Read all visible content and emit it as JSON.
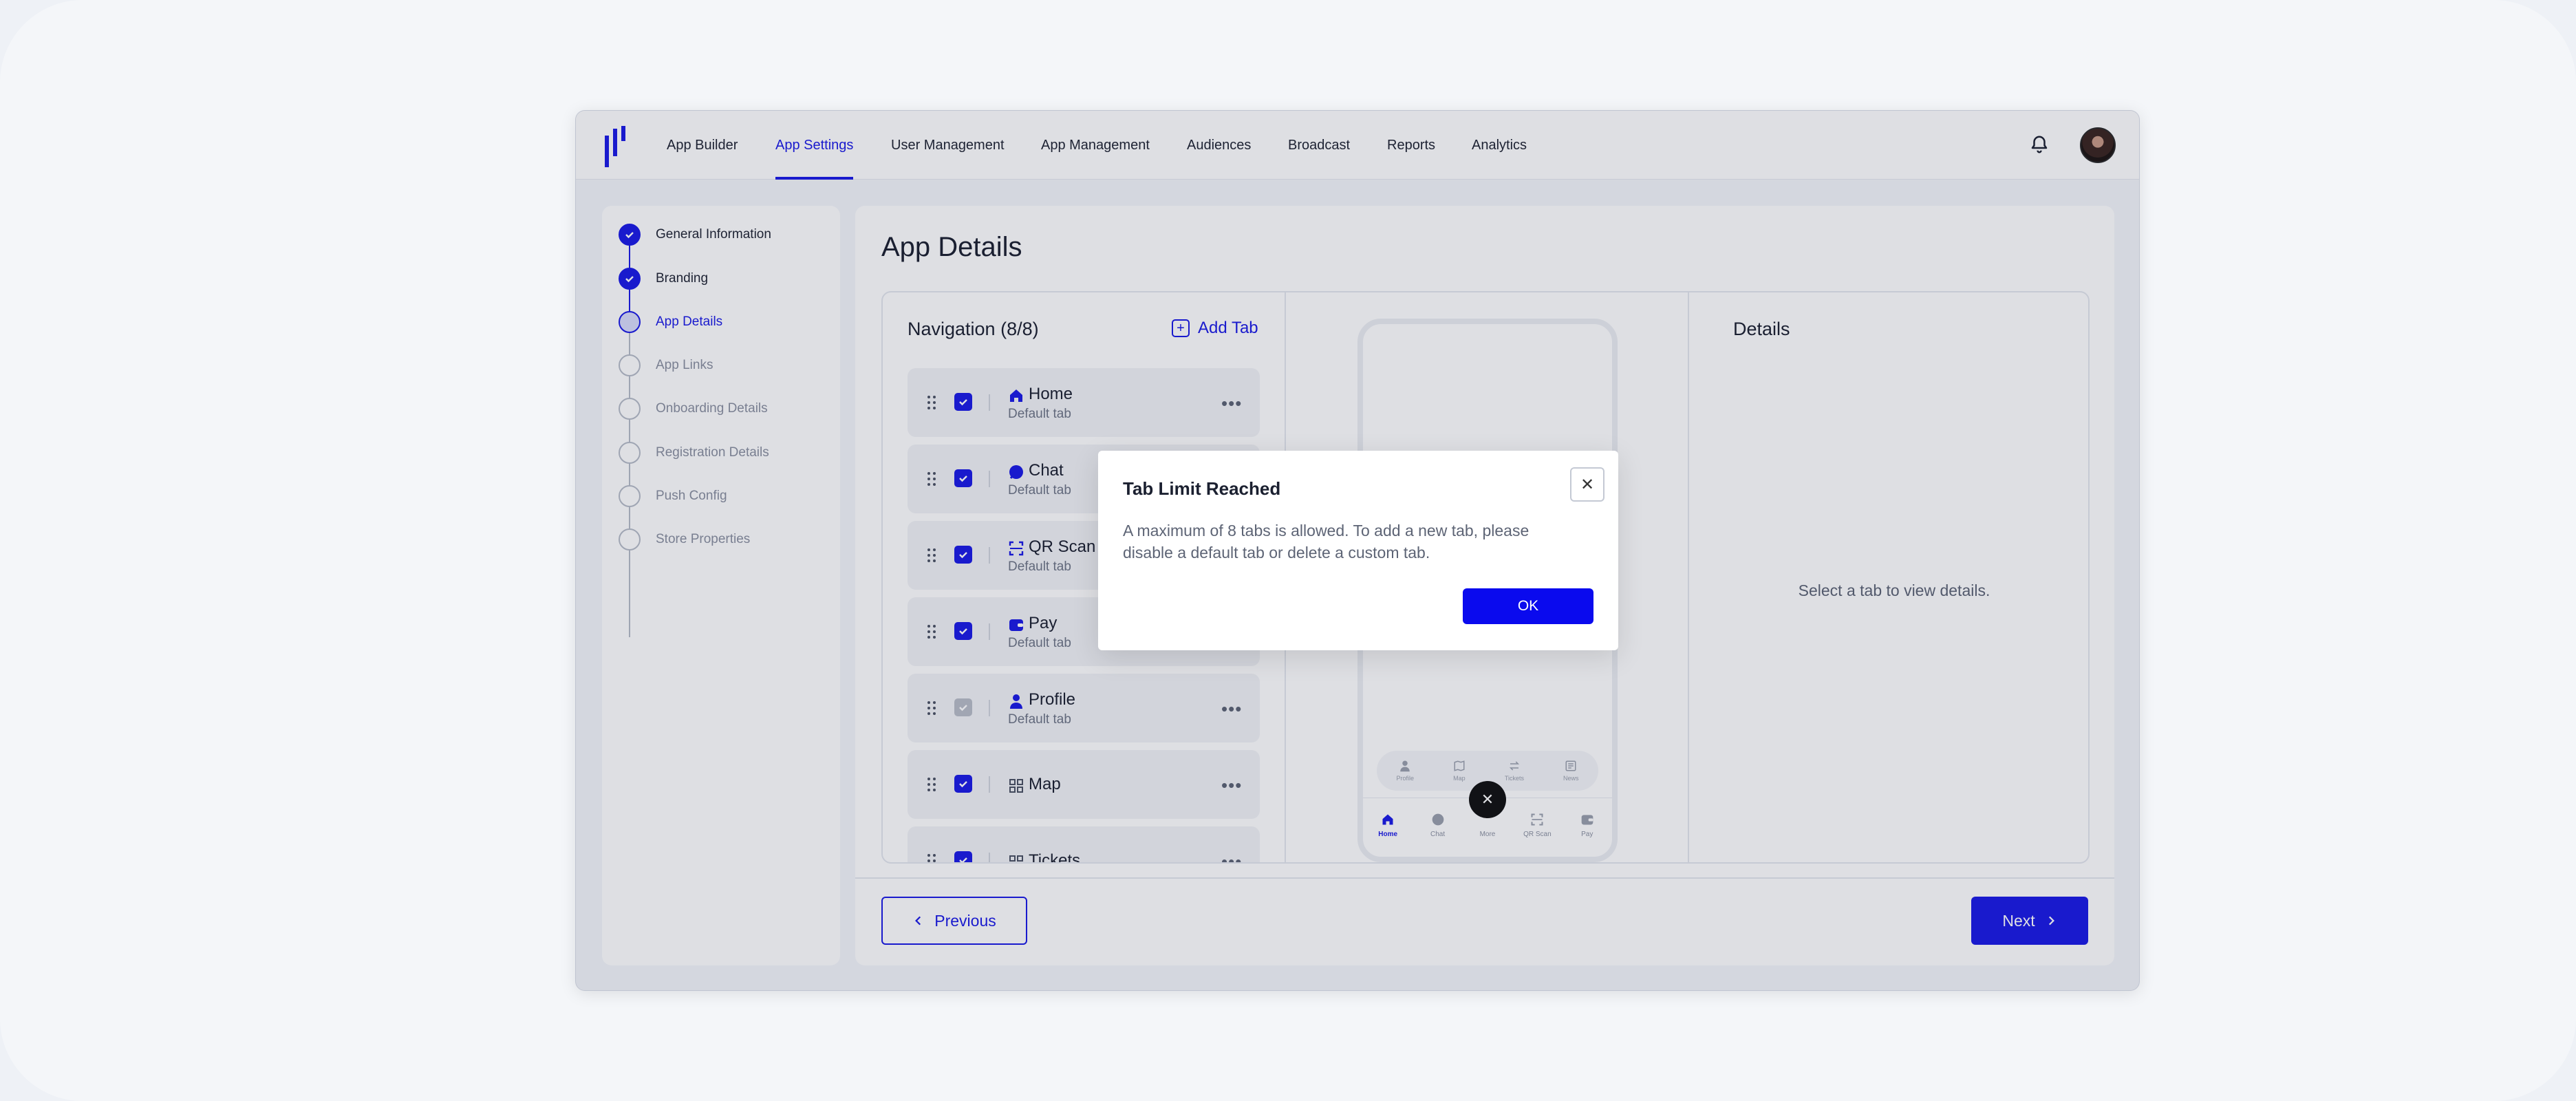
{
  "nav": {
    "items": [
      {
        "label": "App Builder"
      },
      {
        "label": "App Settings"
      },
      {
        "label": "User Management"
      },
      {
        "label": "App Management"
      },
      {
        "label": "Audiences"
      },
      {
        "label": "Broadcast"
      },
      {
        "label": "Reports"
      },
      {
        "label": "Analytics"
      }
    ],
    "active": "App Settings"
  },
  "steps": [
    {
      "label": "General Information",
      "state": "done"
    },
    {
      "label": "Branding",
      "state": "done"
    },
    {
      "label": "App Details",
      "state": "current"
    },
    {
      "label": "App Links",
      "state": "todo"
    },
    {
      "label": "Onboarding Details",
      "state": "todo"
    },
    {
      "label": "Registration Details",
      "state": "todo"
    },
    {
      "label": "Push Config",
      "state": "todo"
    },
    {
      "label": "Store Properties",
      "state": "todo"
    }
  ],
  "page": {
    "title": "App Details",
    "navigation_header": "Navigation (8/8)",
    "add_tab_label": "Add Tab",
    "details_header": "Details",
    "details_empty": "Select a tab to view details."
  },
  "tabs": [
    {
      "name": "Home",
      "sub": "Default tab",
      "icon": "home-icon",
      "checked": true
    },
    {
      "name": "Chat",
      "sub": "Default tab",
      "icon": "chat-icon",
      "checked": true
    },
    {
      "name": "QR Scan",
      "sub": "Default tab",
      "icon": "qr-scan-icon",
      "checked": true
    },
    {
      "name": "Pay",
      "sub": "Default tab",
      "icon": "wallet-icon",
      "checked": true
    },
    {
      "name": "Profile",
      "sub": "Default tab",
      "icon": "user-icon",
      "checked": true,
      "disabled": true
    },
    {
      "name": "Map",
      "sub": "",
      "icon": "grid-icon",
      "checked": true
    },
    {
      "name": "Tickets",
      "sub": "",
      "icon": "grid-icon",
      "checked": true
    }
  ],
  "phone": {
    "tray": [
      {
        "label": "Profile",
        "icon": "user-icon"
      },
      {
        "label": "Map",
        "icon": "map-icon"
      },
      {
        "label": "Tickets",
        "icon": "swap-icon"
      },
      {
        "label": "News",
        "icon": "news-icon"
      }
    ],
    "bottom": [
      {
        "label": "Home",
        "icon": "home-icon",
        "active": true
      },
      {
        "label": "Chat",
        "icon": "chat-icon"
      },
      {
        "label": "More",
        "icon": "more-icon"
      },
      {
        "label": "QR Scan",
        "icon": "qr-scan-icon"
      },
      {
        "label": "Pay",
        "icon": "wallet-icon"
      }
    ]
  },
  "footer": {
    "previous_label": "Previous",
    "next_label": "Next"
  },
  "modal": {
    "title": "Tab Limit Reached",
    "body": "A maximum of 8 tabs is allowed. To add a new tab, please disable a default tab or delete a custom tab.",
    "ok_label": "OK"
  },
  "colors": {
    "accent": "#1a1ae6",
    "page_bg": "#f4f6f9"
  }
}
